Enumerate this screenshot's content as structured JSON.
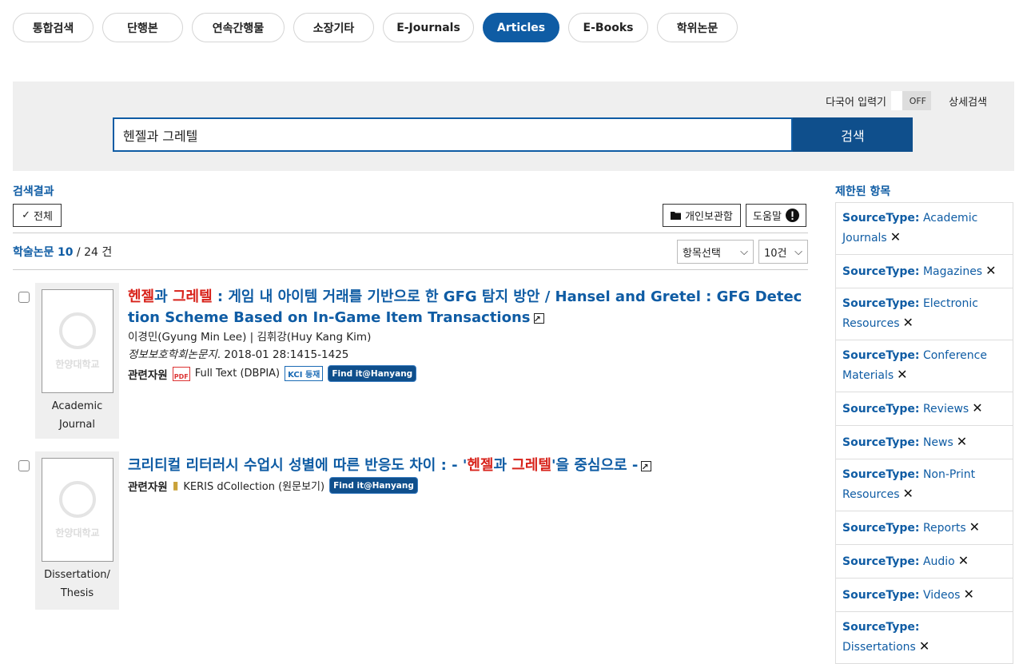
{
  "tabs": [
    {
      "label": "통합검색",
      "active": false
    },
    {
      "label": "단행본",
      "active": false
    },
    {
      "label": "연속간행물",
      "active": false
    },
    {
      "label": "소장기타",
      "active": false
    },
    {
      "label": "E-Journals",
      "active": false
    },
    {
      "label": "Articles",
      "active": true
    },
    {
      "label": "E-Books",
      "active": false
    },
    {
      "label": "학위논문",
      "active": false
    }
  ],
  "search": {
    "multi_label": "다국어 입력기",
    "toggle": "OFF",
    "advanced": "상세검색",
    "value": "헨젤과 그레텔",
    "button": "검색"
  },
  "results": {
    "title": "검색결과",
    "all_button": "전체",
    "personal_button": "개인보관함",
    "help_button": "도움말",
    "count_label": "학술논문",
    "count_shown": "10",
    "count_total": "/ 24 건",
    "field_select": "항목선택",
    "page_size": "10건"
  },
  "items": [
    {
      "title_hl1": "헨젤",
      "title_mid": "과 ",
      "title_hl2": "그레텔",
      "title_rest": " : 게임 내 아이템 거래를 기반으로 한 GFG 탐지 방안 / Hansel and Gretel : GFG Detection Scheme Based on In-Game Item Transactions",
      "authors": "이경민(Gyung Min Lee) | 김휘강(Huy Kang Kim)",
      "journal": "정보보호학회논문지",
      "pub": ". 2018-01 28:1415-1425",
      "resources_label": "관련자원",
      "fulltext": "Full Text (DBPIA)",
      "kci": "KCI 등재",
      "findit": "Find it@Hanyang",
      "type_line1": "Academic",
      "type_line2": "Journal",
      "thumb_text": "한양대학교"
    },
    {
      "title_pre": "크리티컬 리터러시 수업시 성별에 따른 반응도 차이 : - '",
      "title_hl1": "헨젤",
      "title_mid": "과 ",
      "title_hl2": "그레텔",
      "title_rest": "'을 중심으로 -",
      "resources_label": "관련자원",
      "dcollection": "KERIS dCollection (원문보기)",
      "findit": "Find it@Hanyang",
      "type_line1": "Dissertation/",
      "type_line2": "Thesis",
      "thumb_text": "한양대학교"
    }
  ],
  "facets": {
    "title": "제한된 항목",
    "items": [
      {
        "key": "SourceType:",
        "value": "Academic Journals"
      },
      {
        "key": "SourceType:",
        "value": "Magazines"
      },
      {
        "key": "SourceType:",
        "value": "Electronic Resources"
      },
      {
        "key": "SourceType:",
        "value": "Conference Materials"
      },
      {
        "key": "SourceType:",
        "value": "Reviews"
      },
      {
        "key": "SourceType:",
        "value": "News"
      },
      {
        "key": "SourceType:",
        "value": "Non-Print Resources"
      },
      {
        "key": "SourceType:",
        "value": "Reports"
      },
      {
        "key": "SourceType:",
        "value": "Audio"
      },
      {
        "key": "SourceType:",
        "value": "Videos"
      },
      {
        "key": "SourceType:",
        "value": "Dissertations"
      }
    ]
  }
}
